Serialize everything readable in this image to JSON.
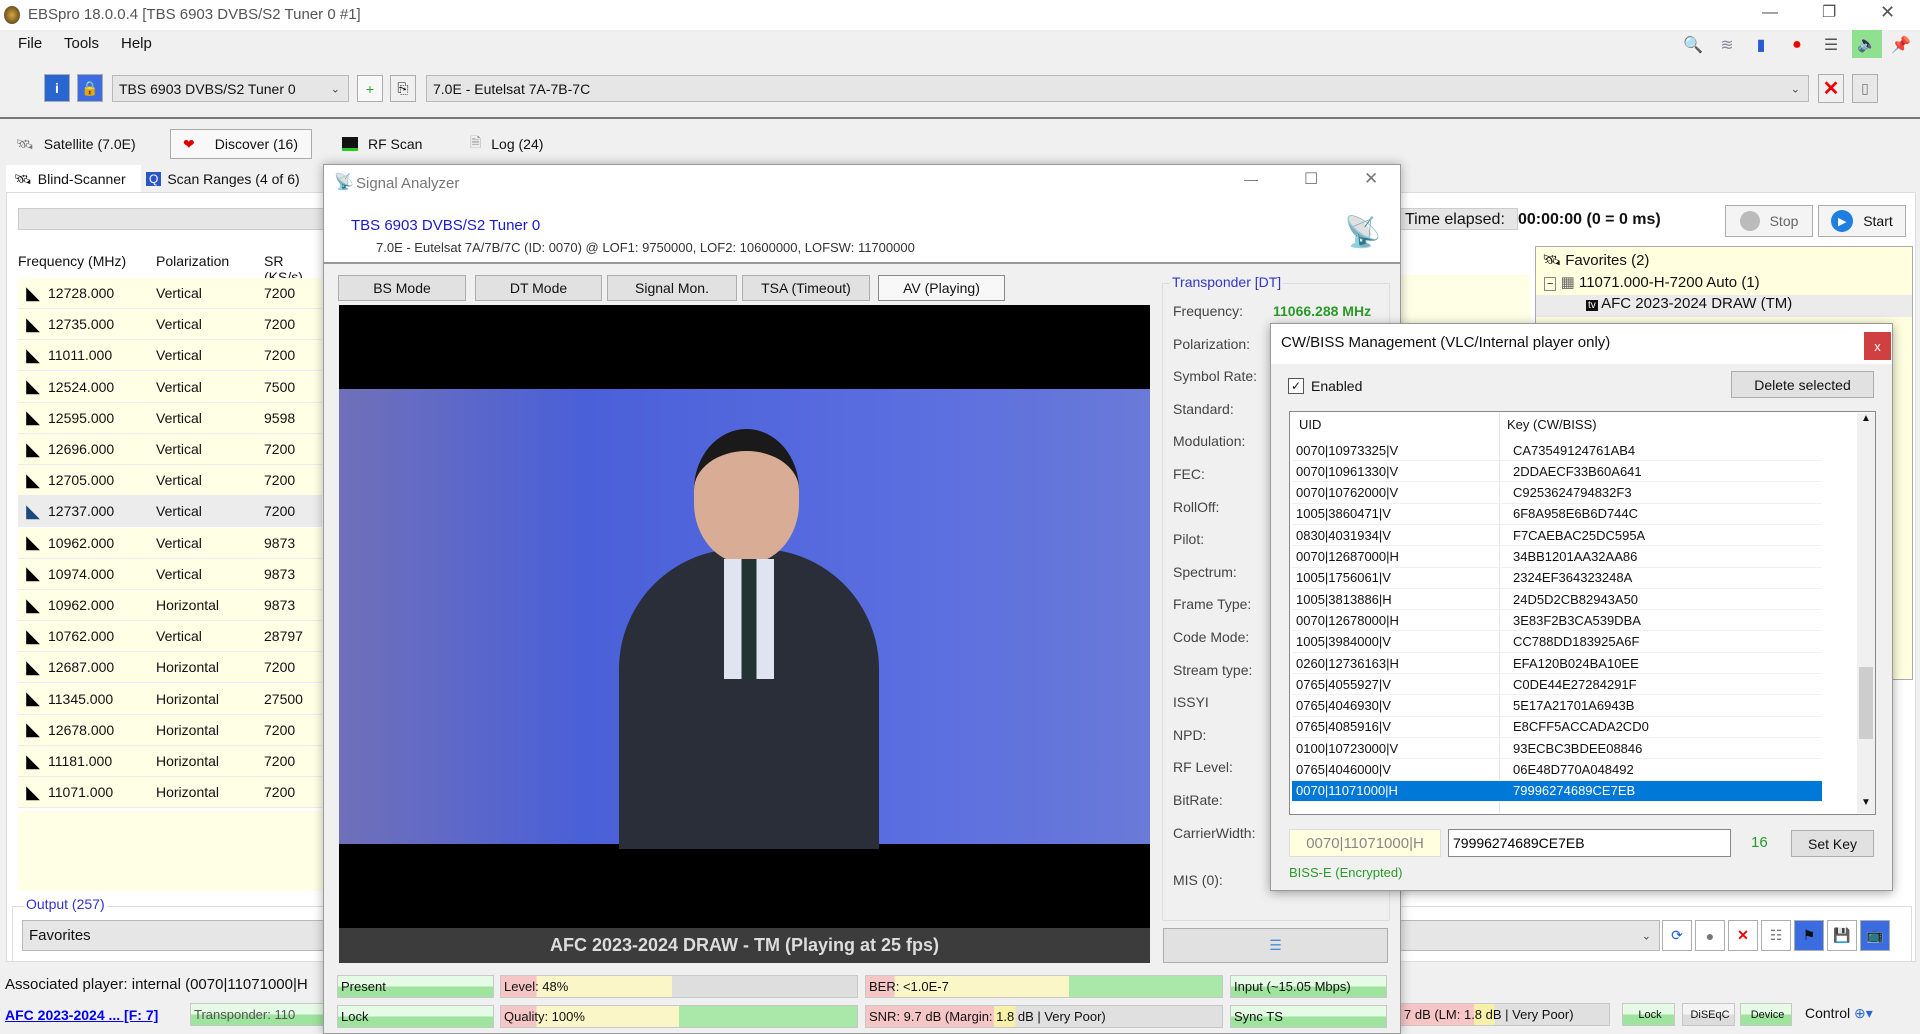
{
  "window": {
    "title": "EBSpro 18.0.0.4 [TBS 6903 DVBS/S2 Tuner 0 #1]"
  },
  "menu": [
    "File",
    "Tools",
    "Help"
  ],
  "toolbar": {
    "tuner": "TBS 6903 DVBS/S2 Tuner 0",
    "satellite": "7.0E - Eutelsat 7A-7B-7C"
  },
  "tabs": [
    "Satellite (7.0E)",
    "Discover (16)",
    "RF Scan",
    "Log (24)"
  ],
  "subtabs": [
    "Blind-Scanner",
    "Scan Ranges (4 of 6)"
  ],
  "scan_table": {
    "headers": [
      "Frequency (MHz)",
      "Polarization",
      "SR (KS/s)"
    ],
    "rows": [
      [
        "12728.000",
        "Vertical",
        "7200"
      ],
      [
        "12735.000",
        "Vertical",
        "7200"
      ],
      [
        "11011.000",
        "Vertical",
        "7200"
      ],
      [
        "12524.000",
        "Vertical",
        "7500"
      ],
      [
        "12595.000",
        "Vertical",
        "9598"
      ],
      [
        "12696.000",
        "Vertical",
        "7200"
      ],
      [
        "12705.000",
        "Vertical",
        "7200"
      ],
      [
        "12737.000",
        "Vertical",
        "7200"
      ],
      [
        "10962.000",
        "Vertical",
        "9873"
      ],
      [
        "10974.000",
        "Vertical",
        "9873"
      ],
      [
        "10962.000",
        "Horizontal",
        "9873"
      ],
      [
        "10762.000",
        "Vertical",
        "28797"
      ],
      [
        "12687.000",
        "Horizontal",
        "7200"
      ],
      [
        "11345.000",
        "Horizontal",
        "27500"
      ],
      [
        "12678.000",
        "Horizontal",
        "7200"
      ],
      [
        "11181.000",
        "Horizontal",
        "7200"
      ],
      [
        "11071.000",
        "Horizontal",
        "7200"
      ]
    ],
    "selected_index": 7
  },
  "output": {
    "label": "Output (257)",
    "value": "Favorites"
  },
  "status": {
    "associated": "Associated player: internal (0070|11071000|H",
    "link": "AFC 2023-2024  ... [F: 7]",
    "transponder": "Transponder: 110",
    "snr_right": "7 dB (LM: 1.8 dB | Very Poor)",
    "lock": "Lock",
    "diseqc": "DiSEqC",
    "device": "Device",
    "control": "Control"
  },
  "scan": {
    "time_label": "Time elapsed:",
    "time_value": "00:00:00 (0 = 0 ms)",
    "stop": "Stop",
    "start": "Start"
  },
  "favorites": {
    "root": "Favorites (2)",
    "tp": "11071.000-H-7200 Auto (1)",
    "channel": "AFC 2023-2024 DRAW (TM)"
  },
  "analyzer": {
    "title": "Signal Analyzer",
    "tuner": "TBS 6903 DVBS/S2 Tuner 0",
    "info": "7.0E - Eutelsat 7A/7B/7C (ID: 0070) @ LOF1: 9750000, LOF2: 10600000, LOFSW: 11700000",
    "tabs": [
      "BS Mode",
      "DT Mode",
      "Signal Mon.",
      "TSA (Timeout)",
      "AV (Playing)"
    ],
    "caption": "AFC 2023-2024 DRAW - TM (Playing at 25 fps)",
    "group": "Transponder [DT]",
    "fields": [
      "Frequency:",
      "Polarization:",
      "Symbol Rate:",
      "Standard:",
      "Modulation:",
      "FEC:",
      "RollOff:",
      "Pilot:",
      "Spectrum:",
      "Frame Type:",
      "Code Mode:",
      "Stream type:",
      "ISSYI",
      "NPD:",
      "RF Level:",
      "BitRate:",
      "CarrierWidth:",
      "MIS (0):"
    ],
    "frequency": "11066.288 MHz",
    "bars": {
      "present": "Present",
      "level": "Level: 48%",
      "ber": "BER: <1.0E-7",
      "input": "Input (~15.05 Mbps)",
      "lock": "Lock",
      "quality": "Quality: 100%",
      "snr": "SNR: 9.7 dB (Margin: 1.8 dB | Very Poor)",
      "sync": "Sync TS"
    },
    "level_pct": 48,
    "quality_pct": 100
  },
  "cw": {
    "title": "CW/BISS Management (VLC/Internal player only)",
    "enabled": "Enabled",
    "delete": "Delete selected",
    "headers": [
      "UID",
      "Key (CW/BISS)"
    ],
    "rows": [
      [
        "0070|10973325|V",
        "CA73549124761AB4"
      ],
      [
        "0070|10961330|V",
        "2DDAECF33B60A641"
      ],
      [
        "0070|10762000|V",
        "C9253624794832F3"
      ],
      [
        "1005|3860471|V",
        "6F8A958E6B6D744C"
      ],
      [
        "0830|4031934|V",
        "F7CAEBAC25DC595A"
      ],
      [
        "0070|12687000|H",
        "34BB1201AA32AA86"
      ],
      [
        "1005|1756061|V",
        "2324EF364323248A"
      ],
      [
        "1005|3813886|H",
        "24D5D2CB82943A50"
      ],
      [
        "0070|12678000|H",
        "3E83F2B3CA539DBA"
      ],
      [
        "1005|3984000|V",
        "CC788DD183925A6F"
      ],
      [
        "0260|12736163|H",
        "EFA120B024BA10EE"
      ],
      [
        "0765|4055927|V",
        "C0DE44E27284291F"
      ],
      [
        "0765|4046930|V",
        "5E17A21701A6943B"
      ],
      [
        "0765|4085916|V",
        "E8CFF5ACCADA2CD0"
      ],
      [
        "0100|10723000|V",
        "93ECBC3BDEE08846"
      ],
      [
        "0765|4046000|V",
        "06E48D770A048492"
      ],
      [
        "0070|11071000|H",
        "79996274689CE7EB"
      ]
    ],
    "selected_index": 16,
    "uid_value": "0070|11071000|H",
    "key_value": "79996274689CE7EB",
    "key_length": "16",
    "set_key": "Set Key",
    "encryption": "BISS-E (Encrypted)"
  },
  "colors": {
    "accent": "#0078d7",
    "link": "#0000ee",
    "green_text": "#2a9a2a",
    "group_title": "#3333cc"
  }
}
